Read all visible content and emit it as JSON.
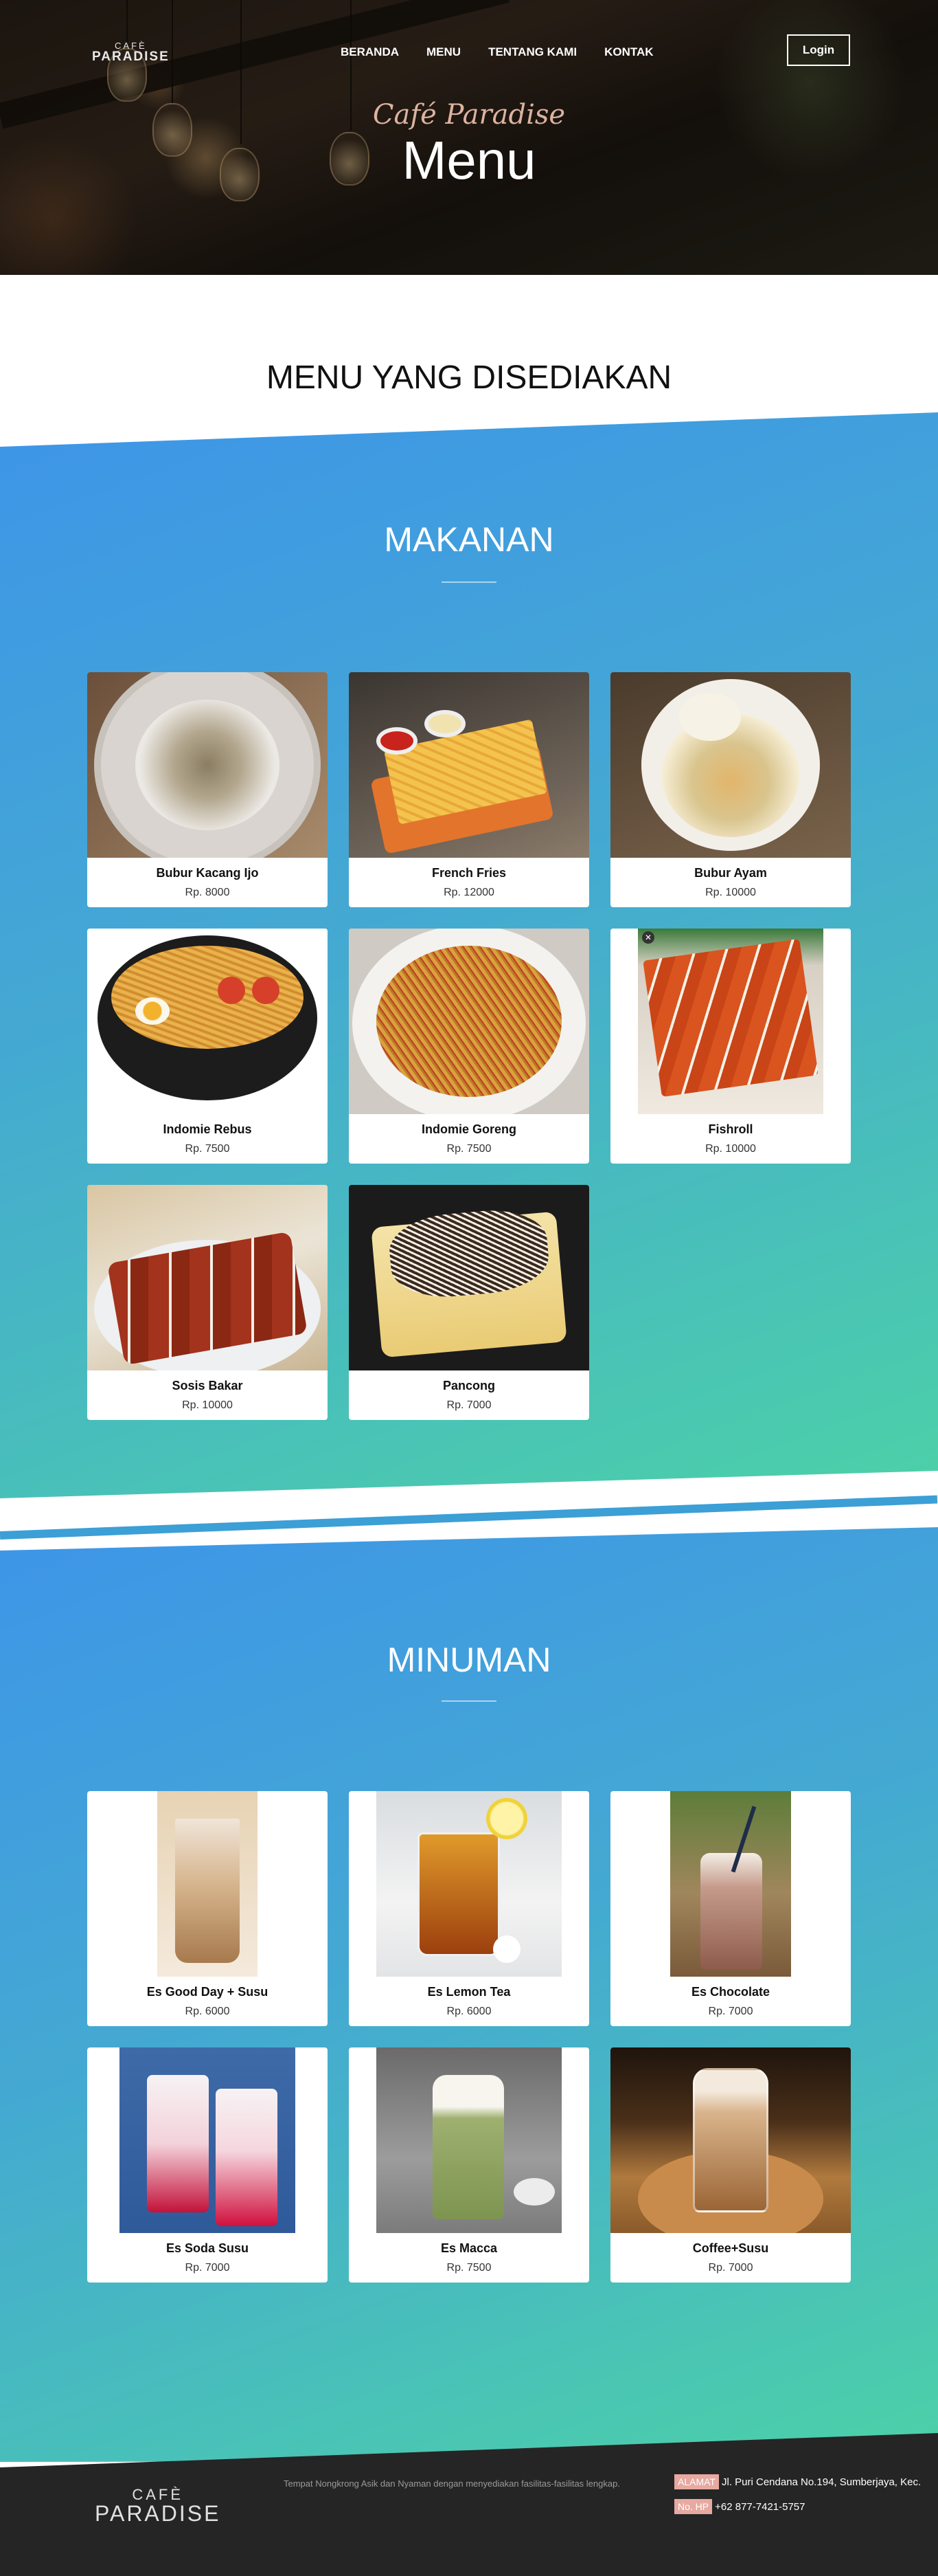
{
  "header": {
    "logo_line1": "CAFÈ",
    "logo_line2": "PARADISE",
    "nav": [
      "BERANDA",
      "MENU",
      "TENTANG KAMI",
      "KONTAK"
    ],
    "login_label": "Login",
    "hero_subtitle": "Café Paradise",
    "hero_title": "Menu"
  },
  "page_heading": "MENU YANG DISEDIAKAN",
  "makanan": {
    "title": "MAKANAN",
    "items": [
      {
        "name": "Bubur Kacang Ijo",
        "price": "Rp. 8000"
      },
      {
        "name": "French Fries",
        "price": "Rp. 12000"
      },
      {
        "name": "Bubur Ayam",
        "price": "Rp. 10000"
      },
      {
        "name": "Indomie Rebus",
        "price": "Rp. 7500"
      },
      {
        "name": "Indomie Goreng",
        "price": "Rp. 7500"
      },
      {
        "name": "Fishroll",
        "price": "Rp. 10000"
      },
      {
        "name": "Sosis Bakar",
        "price": "Rp. 10000"
      },
      {
        "name": "Pancong",
        "price": "Rp. 7000"
      }
    ]
  },
  "minuman": {
    "title": "MINUMAN",
    "items": [
      {
        "name": "Es Good Day + Susu",
        "price": "Rp. 6000"
      },
      {
        "name": "Es Lemon Tea",
        "price": "Rp. 6000"
      },
      {
        "name": "Es Chocolate",
        "price": "Rp. 7000"
      },
      {
        "name": "Es Soda Susu",
        "price": "Rp. 7000"
      },
      {
        "name": "Es Macca",
        "price": "Rp. 7500"
      },
      {
        "name": "Coffee+Susu",
        "price": "Rp. 7000"
      }
    ]
  },
  "footer": {
    "logo_line1": "CAFÈ",
    "logo_line2": "PARADISE",
    "tagline": "Tempat Nongkrong Asik dan Nyaman dengan menyediakan fasilitas-fasilitas lengkap.",
    "address_label": "ALAMAT",
    "address": "Jl. Puri Cendana No.194, Sumberjaya, Kec.",
    "phone_label": "No. HP",
    "phone": "+62 877-7421-5757"
  }
}
